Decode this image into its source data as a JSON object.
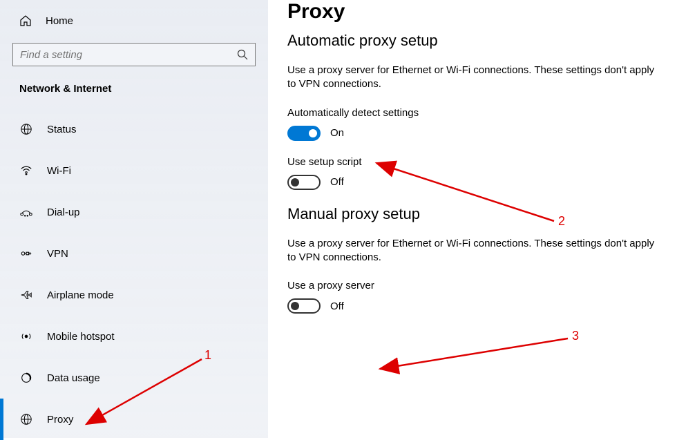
{
  "sidebar": {
    "home_label": "Home",
    "search_placeholder": "Find a setting",
    "category": "Network & Internet",
    "items": [
      {
        "label": "Status"
      },
      {
        "label": "Wi-Fi"
      },
      {
        "label": "Dial-up"
      },
      {
        "label": "VPN"
      },
      {
        "label": "Airplane mode"
      },
      {
        "label": "Mobile hotspot"
      },
      {
        "label": "Data usage"
      },
      {
        "label": "Proxy"
      }
    ]
  },
  "content": {
    "page_title": "Proxy",
    "auto_section_title": "Automatic proxy setup",
    "auto_body": "Use a proxy server for Ethernet or Wi-Fi connections. These settings don't apply to VPN connections.",
    "auto_detect_label": "Automatically detect settings",
    "auto_detect_state": "On",
    "setup_script_label": "Use setup script",
    "setup_script_state": "Off",
    "manual_section_title": "Manual proxy setup",
    "manual_body": "Use a proxy server for Ethernet or Wi-Fi connections. These settings don't apply to VPN connections.",
    "use_proxy_label": "Use a proxy server",
    "use_proxy_state": "Off"
  },
  "annotations": {
    "a1": "1",
    "a2": "2",
    "a3": "3"
  }
}
